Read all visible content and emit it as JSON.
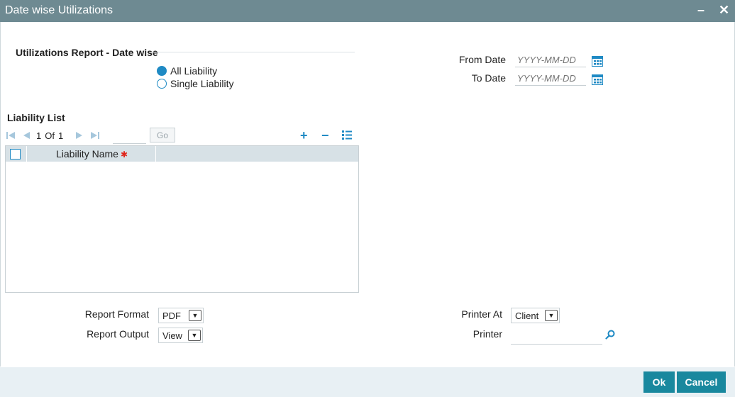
{
  "window": {
    "title": "Date wise Utilizations",
    "minimize_glyph": "–",
    "close_glyph": "✕"
  },
  "report_section": {
    "title": "Utilizations Report - Date wise",
    "options": [
      {
        "label": "All Liability",
        "selected": true
      },
      {
        "label": "Single Liability",
        "selected": false
      }
    ]
  },
  "dates": {
    "from_label": "From Date",
    "from_placeholder": "YYYY-MM-DD",
    "to_label": "To Date",
    "to_placeholder": "YYYY-MM-DD",
    "calendar_icon": "calendar-icon"
  },
  "liability_list": {
    "title": "Liability List",
    "page_current": "1",
    "page_of": "Of",
    "page_total": "1",
    "go_label": "Go",
    "add_icon": "+",
    "delete_icon": "−",
    "columns": [
      "Liability Name"
    ],
    "rows": []
  },
  "report_options": {
    "format_label": "Report Format",
    "format_value": "PDF",
    "output_label": "Report Output",
    "output_value": "View",
    "printer_at_label": "Printer At",
    "printer_at_value": "Client",
    "printer_label": "Printer"
  },
  "footer": {
    "ok_label": "Ok",
    "cancel_label": "Cancel"
  },
  "colors": {
    "titlebar": "#6e8a92",
    "accent": "#1f8ac4",
    "button": "#19889e",
    "footer": "#e8f0f4"
  }
}
